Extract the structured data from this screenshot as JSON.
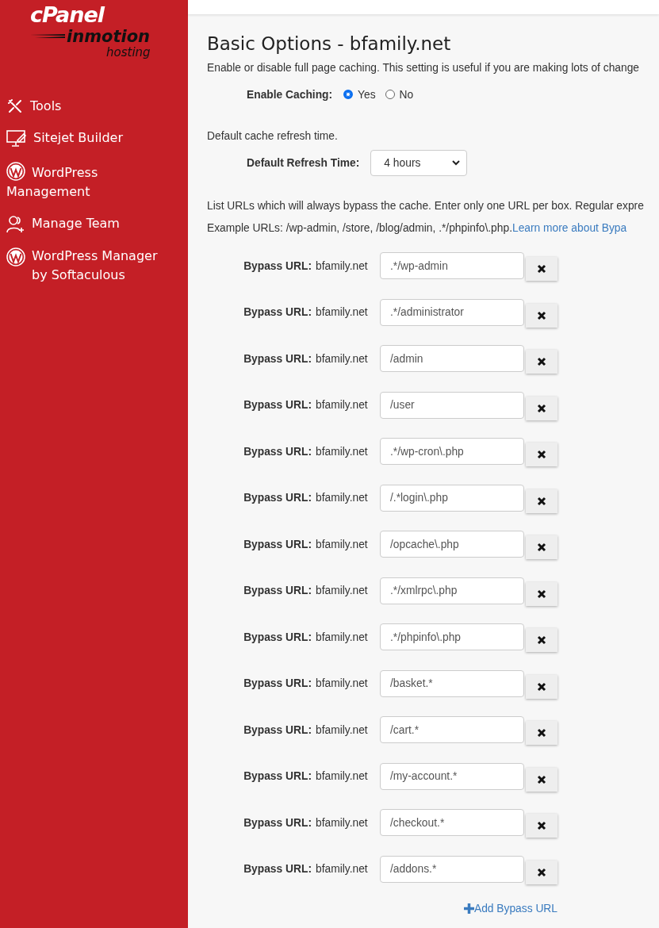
{
  "sidebar": {
    "logo": {
      "brand": "cPanel",
      "partner": "inmotion",
      "partner_sub": "hosting"
    },
    "items": [
      {
        "label": "Tools",
        "kind": "tools"
      },
      {
        "label": "Sitejet Builder",
        "kind": "builder"
      },
      {
        "label": "WordPress Management",
        "kind": "wordpress"
      },
      {
        "label": "Manage Team",
        "kind": "team"
      },
      {
        "label": "WordPress Manager by Softaculous",
        "kind": "wordpress"
      }
    ]
  },
  "main": {
    "title": "Basic Options - bfamily.net",
    "caching_description": "Enable or disable full page caching. This setting is useful if you are making lots of change",
    "enable_caching": {
      "label": "Enable Caching:",
      "options": [
        {
          "label": "Yes",
          "selected": true
        },
        {
          "label": "No",
          "selected": false
        }
      ]
    },
    "refresh_description": "Default cache refresh time.",
    "refresh_time": {
      "label": "Default Refresh Time:",
      "value": "4 hours"
    },
    "bypass_description": "List URLs which will always bypass the cache. Enter only one URL per box. Regular expre",
    "example_text": "Example URLs: /wp-admin, /store, /blog/admin, .*/phpinfo\\.php.",
    "learn_more_link": "Learn more about Bypa",
    "bypass_rows": [
      {
        "label": "Bypass URL:",
        "domain": "bfamily.net",
        "value": ".*/wp-admin"
      },
      {
        "label": "Bypass URL:",
        "domain": "bfamily.net",
        "value": ".*/administrator"
      },
      {
        "label": "Bypass URL:",
        "domain": "bfamily.net",
        "value": "/admin"
      },
      {
        "label": "Bypass URL:",
        "domain": "bfamily.net",
        "value": "/user"
      },
      {
        "label": "Bypass URL:",
        "domain": "bfamily.net",
        "value": ".*/wp-cron\\.php"
      },
      {
        "label": "Bypass URL:",
        "domain": "bfamily.net",
        "value": "/.*login\\.php"
      },
      {
        "label": "Bypass URL:",
        "domain": "bfamily.net",
        "value": "/opcache\\.php"
      },
      {
        "label": "Bypass URL:",
        "domain": "bfamily.net",
        "value": ".*/xmlrpc\\.php"
      },
      {
        "label": "Bypass URL:",
        "domain": "bfamily.net",
        "value": ".*/phpinfo\\.php"
      },
      {
        "label": "Bypass URL:",
        "domain": "bfamily.net",
        "value": "/basket.*"
      },
      {
        "label": "Bypass URL:",
        "domain": "bfamily.net",
        "value": "/cart.*"
      },
      {
        "label": "Bypass URL:",
        "domain": "bfamily.net",
        "value": "/my-account.*"
      },
      {
        "label": "Bypass URL:",
        "domain": "bfamily.net",
        "value": "/checkout.*"
      },
      {
        "label": "Bypass URL:",
        "domain": "bfamily.net",
        "value": "/addons.*"
      }
    ],
    "add_link": "Add Bypass URL"
  }
}
